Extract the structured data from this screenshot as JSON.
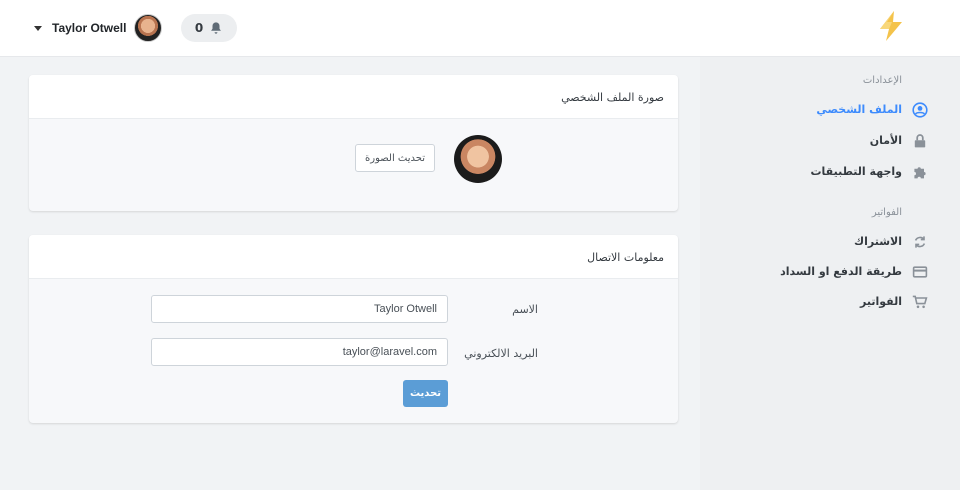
{
  "header": {
    "user_name": "Taylor Otwell",
    "notification_count": "0"
  },
  "sidebar": {
    "settings_title": "الإعدادات",
    "settings_items": [
      {
        "label": "الملف الشخصي",
        "icon": "user-circle-icon",
        "active": true
      },
      {
        "label": "الأمان",
        "icon": "lock-icon",
        "active": false
      },
      {
        "label": "واجهة التطبيقات",
        "icon": "puzzle-icon",
        "active": false
      }
    ],
    "billing_title": "الفواتير",
    "billing_items": [
      {
        "label": "الاشتراك",
        "icon": "refresh-icon"
      },
      {
        "label": "طريقة الدفع او السداد",
        "icon": "credit-card-icon"
      },
      {
        "label": "الفواتير",
        "icon": "cart-icon"
      }
    ]
  },
  "photo_card": {
    "title": "صورة الملف الشخصي",
    "update_button": "تحديث الصورة"
  },
  "contact_card": {
    "title": "معلومات الاتصال",
    "name_label": "الاسم",
    "name_value": "Taylor Otwell",
    "email_label": "البريد الالكتروني",
    "email_value": "taylor@laravel.com",
    "submit_button": "تحديث"
  },
  "colors": {
    "accent": "#3d8bfd",
    "button": "#5b9dd6",
    "logo": "#f4c34b"
  }
}
